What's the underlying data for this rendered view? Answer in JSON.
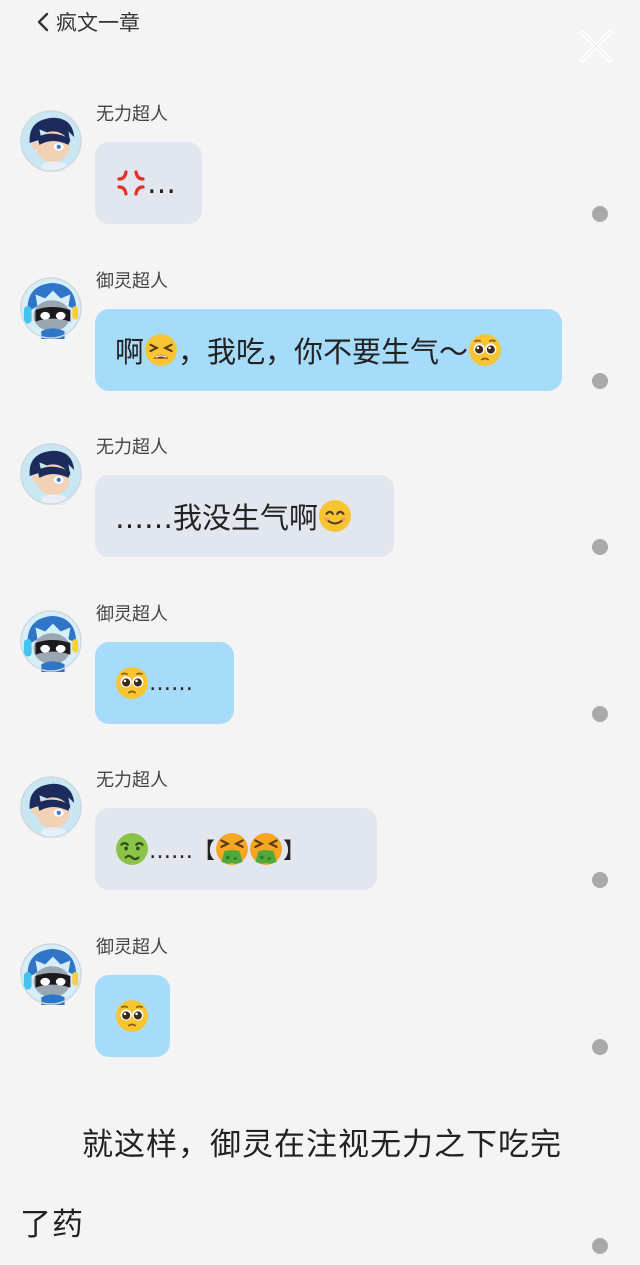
{
  "header": {
    "back_label": "疯文一章"
  },
  "characters": {
    "wuli": "无力超人",
    "yuling": "御灵超人"
  },
  "messages": [
    {
      "speaker": "无力超人",
      "parts": [
        "anger",
        "…"
      ]
    },
    {
      "speaker": "御灵超人",
      "parts": [
        "啊",
        "tired",
        "，我吃，你不要生气～",
        "pleading"
      ]
    },
    {
      "speaker": "无力超人",
      "parts": [
        "……我没生气啊",
        "smile"
      ]
    },
    {
      "speaker": "御灵超人",
      "parts": [
        "pleading",
        "……"
      ]
    },
    {
      "speaker": "无力超人",
      "parts": [
        "sick",
        "……【",
        "vomit",
        "vomit",
        "】"
      ]
    },
    {
      "speaker": "御灵超人",
      "parts": [
        "pleading"
      ]
    }
  ],
  "narration": {
    "line1": "就这样，御灵在注视无力之下吃完",
    "line2": "了药"
  },
  "icons": {
    "back": "chevron-left-icon",
    "close": "close-icon",
    "anger": "anger-symbol-emoji",
    "tired": "tired-face-emoji",
    "pleading": "pleading-face-emoji",
    "smile": "smiling-face-emoji",
    "sick": "nauseated-face-emoji",
    "vomit": "vomiting-face-emoji"
  },
  "colors": {
    "gray_bubble": "#e2e6ee",
    "blue_bubble": "#a6dcfa",
    "background": "#f4f4f5",
    "dot": "#a9a9a9"
  }
}
